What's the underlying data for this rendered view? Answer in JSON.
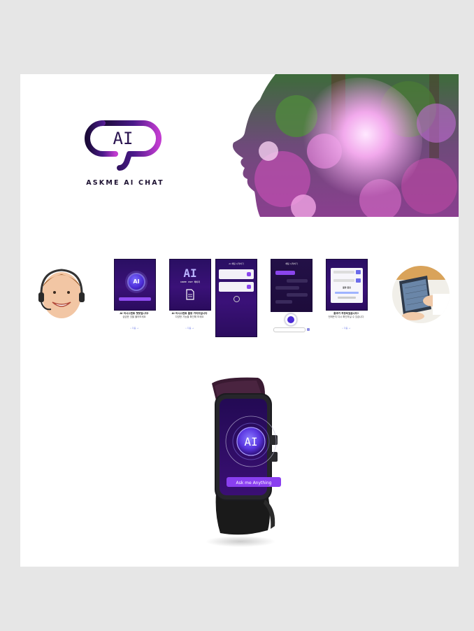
{
  "hero": {
    "logo_text": "AI",
    "brand_name": "ASKME AI CHAT"
  },
  "screens": [
    {
      "button": "Ask me Anything",
      "caption_title": "AI 어시스턴트 챗봇입니다!",
      "caption_sub": "궁금한 것을 물어보세요",
      "link": "• 다음 →"
    },
    {
      "logo": "AI",
      "subtitle": "ASKME CHAT 페이지",
      "caption_title": "AI 어시스턴트 활용 가이드입니다",
      "caption_sub": "다양한 기능을 확인해 보세요",
      "link": "• 다음 →"
    },
    {
      "header": "AI 채팅 시작하기"
    },
    {
      "header": "채팅 시작하기"
    },
    {
      "result": "결과 완료",
      "caption_title": "결과가 저장되었습니다!",
      "caption_sub": "언제든지 다시 확인하실 수 있습니다",
      "link": "• 다음 →"
    }
  ],
  "watch": {
    "logo_text": "AI",
    "button": "Ask me Anything"
  },
  "colors": {
    "background": "#e6e6e6",
    "brand_purple": "#6b2bd9",
    "deep_purple": "#2a0f63",
    "button_violet": "#8a3ff0"
  },
  "icons": [
    "headset-person-photo",
    "laptop-hands-photo",
    "forest-face-image",
    "smartwatch-image",
    "document-icon",
    "send-icon"
  ]
}
